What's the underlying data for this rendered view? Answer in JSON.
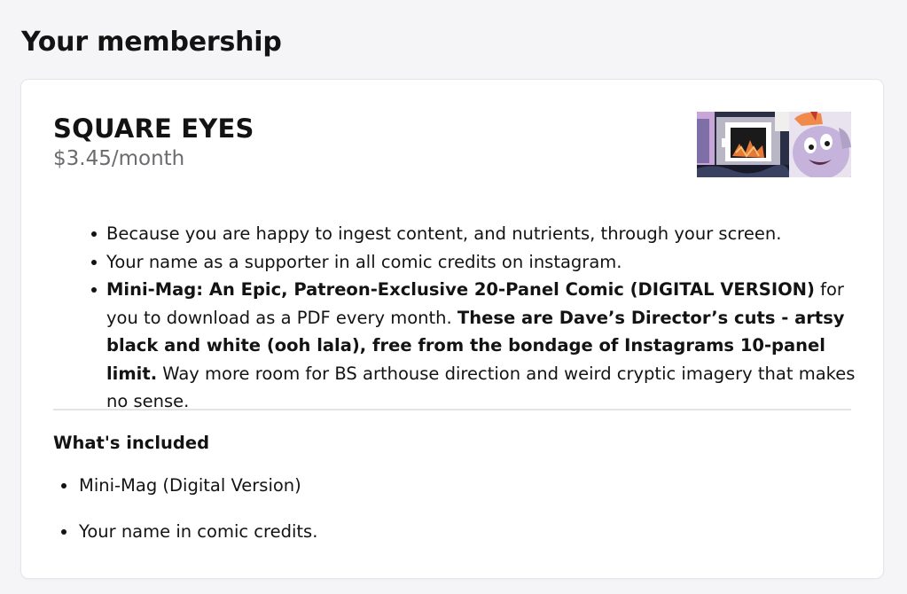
{
  "page": {
    "title": "Your membership"
  },
  "tier": {
    "name": "SQUARE EYES",
    "price": "$3.45/month",
    "image_alt": "square-eyes-tier-artwork",
    "description": [
      {
        "parts": [
          {
            "text": "Because you are happy to ingest content, and nutrients, through your screen.",
            "bold": false
          }
        ]
      },
      {
        "parts": [
          {
            "text": "Your name as a supporter in all comic credits on instagram.",
            "bold": false
          }
        ]
      },
      {
        "parts": [
          {
            "text": "Mini-Mag: An Epic, Patreon-Exclusive 20-Panel Comic (DIGITAL VERSION)",
            "bold": true
          },
          {
            "text": " for you to download as a PDF every month. ",
            "bold": false
          },
          {
            "text": "These are Dave’s Director’s cuts - artsy black and white (ooh lala), free from the bondage of Instagrams 10-panel limit.",
            "bold": true
          },
          {
            "text": " Way more room for BS arthouse direction and weird cryptic imagery that makes no sense.",
            "bold": false
          }
        ]
      }
    ]
  },
  "included": {
    "heading": "What's included",
    "items": [
      "Mini-Mag (Digital Version)",
      "Your name in comic credits."
    ]
  },
  "colors": {
    "page_background": "#f5f5f7",
    "card_background": "#ffffff",
    "text_primary": "#131313",
    "text_secondary": "#6b6b70",
    "divider": "#e4e4e8"
  }
}
